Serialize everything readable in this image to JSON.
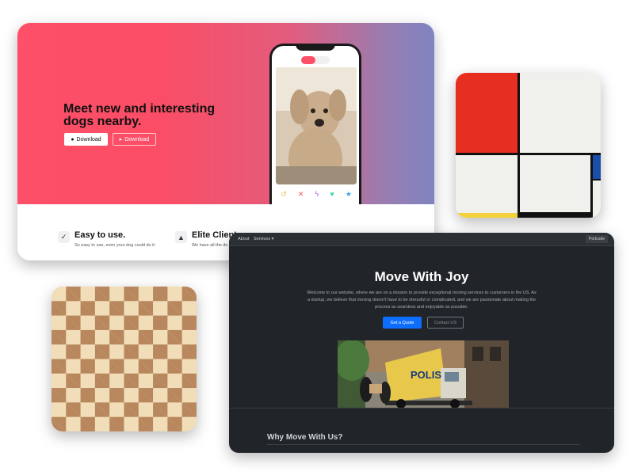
{
  "dog_app": {
    "headline": "Meet new and interesting dogs nearby.",
    "download_apple": "Download",
    "download_play": "Download",
    "features": [
      {
        "title": "Easy to use.",
        "desc": "So easy to use, even your dog could do it."
      },
      {
        "title": "Elite Client",
        "desc": "We have all the do"
      }
    ],
    "colors": {
      "gradient_start": "#fd5068",
      "gradient_end": "#7f85c2"
    }
  },
  "moving": {
    "nav": {
      "about": "About",
      "services": "Services",
      "brand": "Portcode"
    },
    "title": "Move With Joy",
    "text": "Welcome to our website, where we are on a mission to provide exceptional moving services to customers in the US. As a startup, we believe that moving doesn't have to be stressful or complicated, and we are passionate about making the process as seamless and enjoyable as possible.",
    "quote_button": "Get a Quote",
    "contact_button": "Contact US",
    "truck_sign": "POLIS",
    "why_heading": "Why Move With Us?",
    "colors": {
      "accent": "#0d6efd",
      "background": "#212529"
    }
  }
}
